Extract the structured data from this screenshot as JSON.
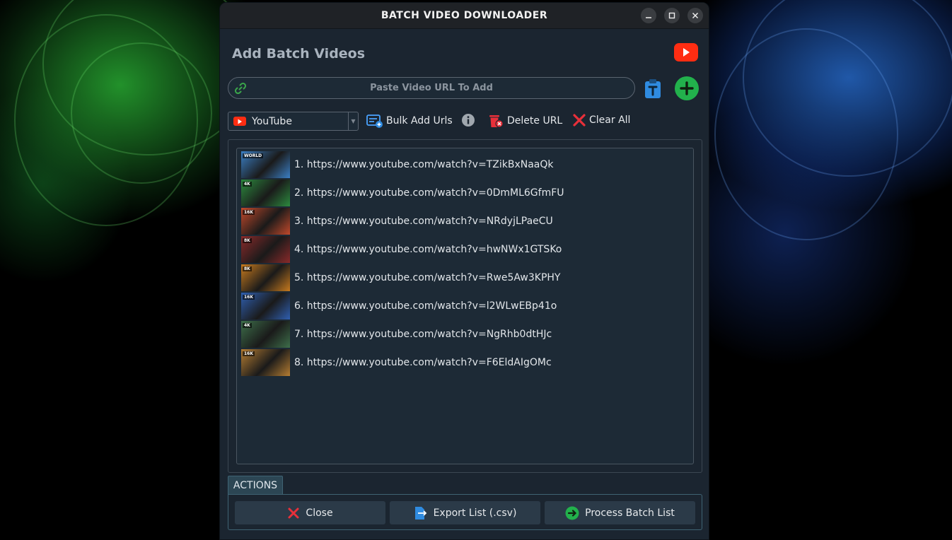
{
  "window": {
    "title": "BATCH VIDEO DOWNLOADER",
    "minimize_icon": "minimize-icon",
    "maximize_icon": "maximize-icon",
    "close_icon": "close-icon"
  },
  "header": {
    "title": "Add Batch Videos",
    "logo_icon": "youtube-logo-icon"
  },
  "url_input": {
    "placeholder": "Paste Video URL To Add",
    "value": ""
  },
  "toolbar": {
    "source": "YouTube",
    "bulk_add_label": "Bulk Add Urls",
    "delete_label": "Delete URL",
    "clear_label": "Clear All"
  },
  "videos": [
    {
      "url": "1. https://www.youtube.com/watch?v=TZikBxNaaQk",
      "thumb_color": "#3b7fc4",
      "thumb_badge": "WORLD"
    },
    {
      "url": "2. https://www.youtube.com/watch?v=0DmML6GfmFU",
      "thumb_color": "#2c8a3e",
      "thumb_badge": "4K"
    },
    {
      "url": "3. https://www.youtube.com/watch?v=NRdyjLPaeCU",
      "thumb_color": "#c2492b",
      "thumb_badge": "16K"
    },
    {
      "url": "4. https://www.youtube.com/watch?v=hwNWx1GTSKo",
      "thumb_color": "#8a2a2a",
      "thumb_badge": "8K"
    },
    {
      "url": "5. https://www.youtube.com/watch?v=Rwe5Aw3KPHY",
      "thumb_color": "#c77a1e",
      "thumb_badge": "8K"
    },
    {
      "url": "6. https://www.youtube.com/watch?v=l2WLwEBp41o",
      "thumb_color": "#2f5fb0",
      "thumb_badge": "16K"
    },
    {
      "url": "7. https://www.youtube.com/watch?v=NgRhb0dtHJc",
      "thumb_color": "#3d6e4a",
      "thumb_badge": "4K"
    },
    {
      "url": "8. https://www.youtube.com/watch?v=F6EldAIgOMc",
      "thumb_color": "#b57d32",
      "thumb_badge": "16K"
    }
  ],
  "actions": {
    "tab_label": "ACTIONS",
    "close_label": "Close",
    "export_label": "Export List (.csv)",
    "process_label": "Process Batch List"
  },
  "colors": {
    "accent_green": "#22b14c",
    "accent_red": "#e8303a",
    "accent_blue": "#2f8be0",
    "youtube_red": "#ff2d12"
  }
}
